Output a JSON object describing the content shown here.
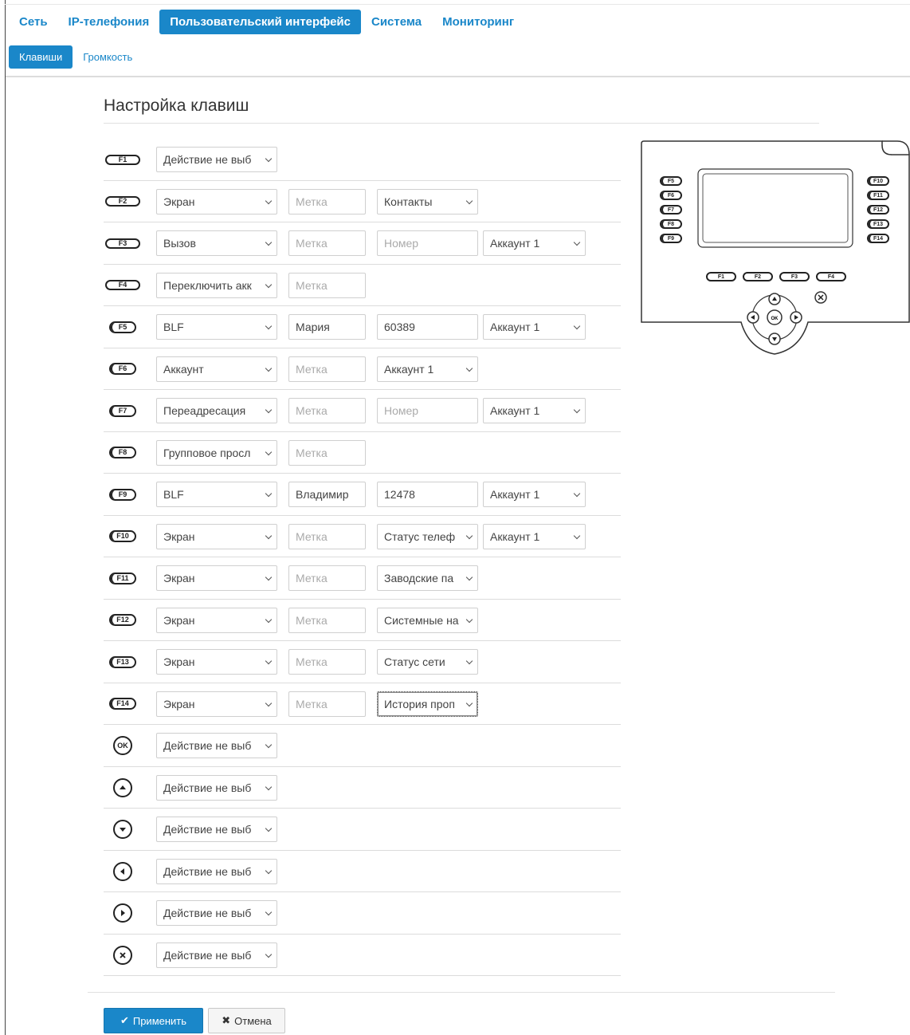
{
  "nav": {
    "main_tabs": [
      {
        "label": "Сеть",
        "active": false
      },
      {
        "label": "IP-телефония",
        "active": false
      },
      {
        "label": "Пользовательский интерфейс",
        "active": true
      },
      {
        "label": "Система",
        "active": false
      },
      {
        "label": "Мониторинг",
        "active": false
      }
    ],
    "sub_tabs": [
      {
        "label": "Клавиши",
        "active": true
      },
      {
        "label": "Громкость",
        "active": false
      }
    ]
  },
  "page": {
    "title": "Настройка клавиш"
  },
  "keys": [
    {
      "key": "F1",
      "icon": "f1-key-icon",
      "action": "Действие не выб"
    },
    {
      "key": "F2",
      "icon": "f2-key-icon",
      "action": "Экран",
      "label_placeholder": "Метка",
      "param": "Контакты"
    },
    {
      "key": "F3",
      "icon": "f3-key-icon",
      "action": "Вызов",
      "label_placeholder": "Метка",
      "number_placeholder": "Номер",
      "account": "Аккаунт 1"
    },
    {
      "key": "F4",
      "icon": "f4-key-icon",
      "action": "Переключить акк",
      "label_placeholder": "Метка"
    },
    {
      "key": "F5",
      "icon": "f5-key-icon",
      "action": "BLF",
      "label": "Мария",
      "number": "60389",
      "account": "Аккаунт 1"
    },
    {
      "key": "F6",
      "icon": "f6-key-icon",
      "action": "Аккаунт",
      "label_placeholder": "Метка",
      "param": "Аккаунт 1"
    },
    {
      "key": "F7",
      "icon": "f7-key-icon",
      "action": "Переадресация",
      "label_placeholder": "Метка",
      "number_placeholder": "Номер",
      "account": "Аккаунт 1"
    },
    {
      "key": "F8",
      "icon": "f8-key-icon",
      "action": "Групповое просл",
      "label_placeholder": "Метка"
    },
    {
      "key": "F9",
      "icon": "f9-key-icon",
      "action": "BLF",
      "label": "Владимир",
      "number": "12478",
      "account": "Аккаунт 1"
    },
    {
      "key": "F10",
      "icon": "f10-key-icon",
      "action": "Экран",
      "label_placeholder": "Метка",
      "param": "Статус телеф",
      "account": "Аккаунт 1"
    },
    {
      "key": "F11",
      "icon": "f11-key-icon",
      "action": "Экран",
      "label_placeholder": "Метка",
      "param": "Заводские па"
    },
    {
      "key": "F12",
      "icon": "f12-key-icon",
      "action": "Экран",
      "label_placeholder": "Метка",
      "param": "Системные на"
    },
    {
      "key": "F13",
      "icon": "f13-key-icon",
      "action": "Экран",
      "label_placeholder": "Метка",
      "param": "Статус сети"
    },
    {
      "key": "F14",
      "icon": "f14-key-icon",
      "action": "Экран",
      "label_placeholder": "Метка",
      "param": "История проп"
    },
    {
      "key": "OK",
      "icon": "ok-key-icon",
      "action": "Действие не выб"
    },
    {
      "key": "▲",
      "icon": "up-key-icon",
      "action": "Действие не выб"
    },
    {
      "key": "▼",
      "icon": "down-key-icon",
      "action": "Действие не выб"
    },
    {
      "key": "◀",
      "icon": "left-key-icon",
      "action": "Действие не выб"
    },
    {
      "key": "▶",
      "icon": "right-key-icon",
      "action": "Действие не выб"
    },
    {
      "key": "✕",
      "icon": "cancel-key-icon",
      "action": "Действие не выб"
    }
  ],
  "device": {
    "side_left_keys": [
      "F5",
      "F6",
      "F7",
      "F8",
      "F9"
    ],
    "side_right_keys": [
      "F10",
      "F11",
      "F12",
      "F13",
      "F14"
    ],
    "bottom_keys": [
      "F1",
      "F2",
      "F3",
      "F4"
    ],
    "ok_label": "OK"
  },
  "footer": {
    "apply_label": "Применить",
    "apply_icon": "check-icon",
    "cancel_label": "Отмена",
    "cancel_icon": "cross-icon"
  },
  "colors": {
    "accent": "#1a87c9",
    "border": "#cfcfcf"
  }
}
